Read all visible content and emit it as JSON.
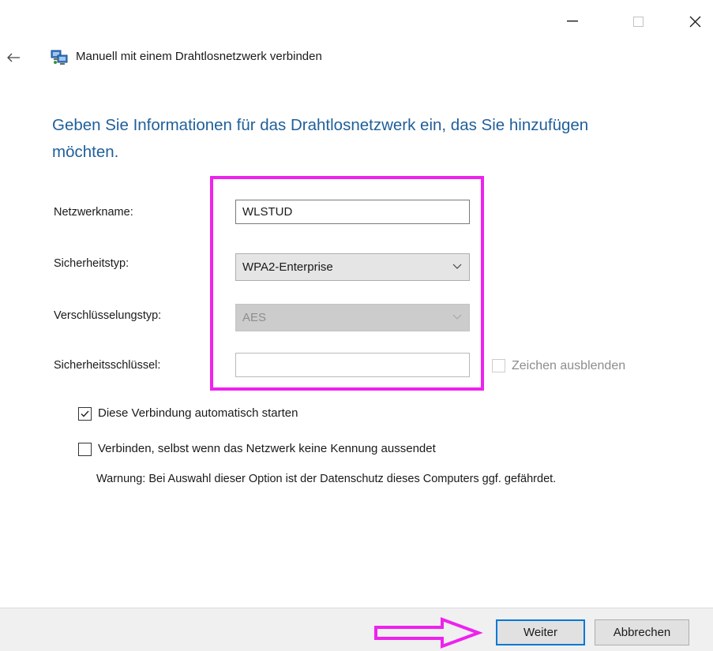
{
  "window": {
    "title": "Manuell mit einem Drahtlosnetzwerk verbinden",
    "controls": {
      "minimize_icon": "minimize-icon",
      "maximize_icon": "maximize-icon",
      "close_icon": "close-icon"
    },
    "back_icon": "back-arrow-icon",
    "app_icon": "network-icon"
  },
  "instruction": "Geben Sie Informationen für das Drahtlosnetzwerk ein, das Sie hinzufügen möchten.",
  "form": {
    "network_name": {
      "label": "Netzwerkname:",
      "value": "WLSTUD"
    },
    "security_type": {
      "label": "Sicherheitstyp:",
      "selected": "WPA2-Enterprise"
    },
    "encryption_type": {
      "label": "Verschlüsselungstyp:",
      "selected": "AES",
      "disabled": true
    },
    "security_key": {
      "label": "Sicherheitsschlüssel:",
      "value": ""
    },
    "hide_characters": {
      "label": "Zeichen ausblenden",
      "checked": false,
      "disabled": true
    }
  },
  "options": {
    "auto_start": {
      "label": "Diese Verbindung automatisch starten",
      "checked": true
    },
    "connect_hidden": {
      "label": "Verbinden, selbst wenn das Netzwerk keine Kennung aussendet",
      "checked": false
    },
    "warning": "Warnung: Bei Auswahl dieser Option ist der Datenschutz dieses Computers ggf. gefährdet."
  },
  "footer": {
    "next_label": "Weiter",
    "cancel_label": "Abbrechen"
  },
  "colors": {
    "instruction": "#1f5f9a",
    "annotation": "#ee22ee",
    "focus_border": "#0078d7"
  }
}
